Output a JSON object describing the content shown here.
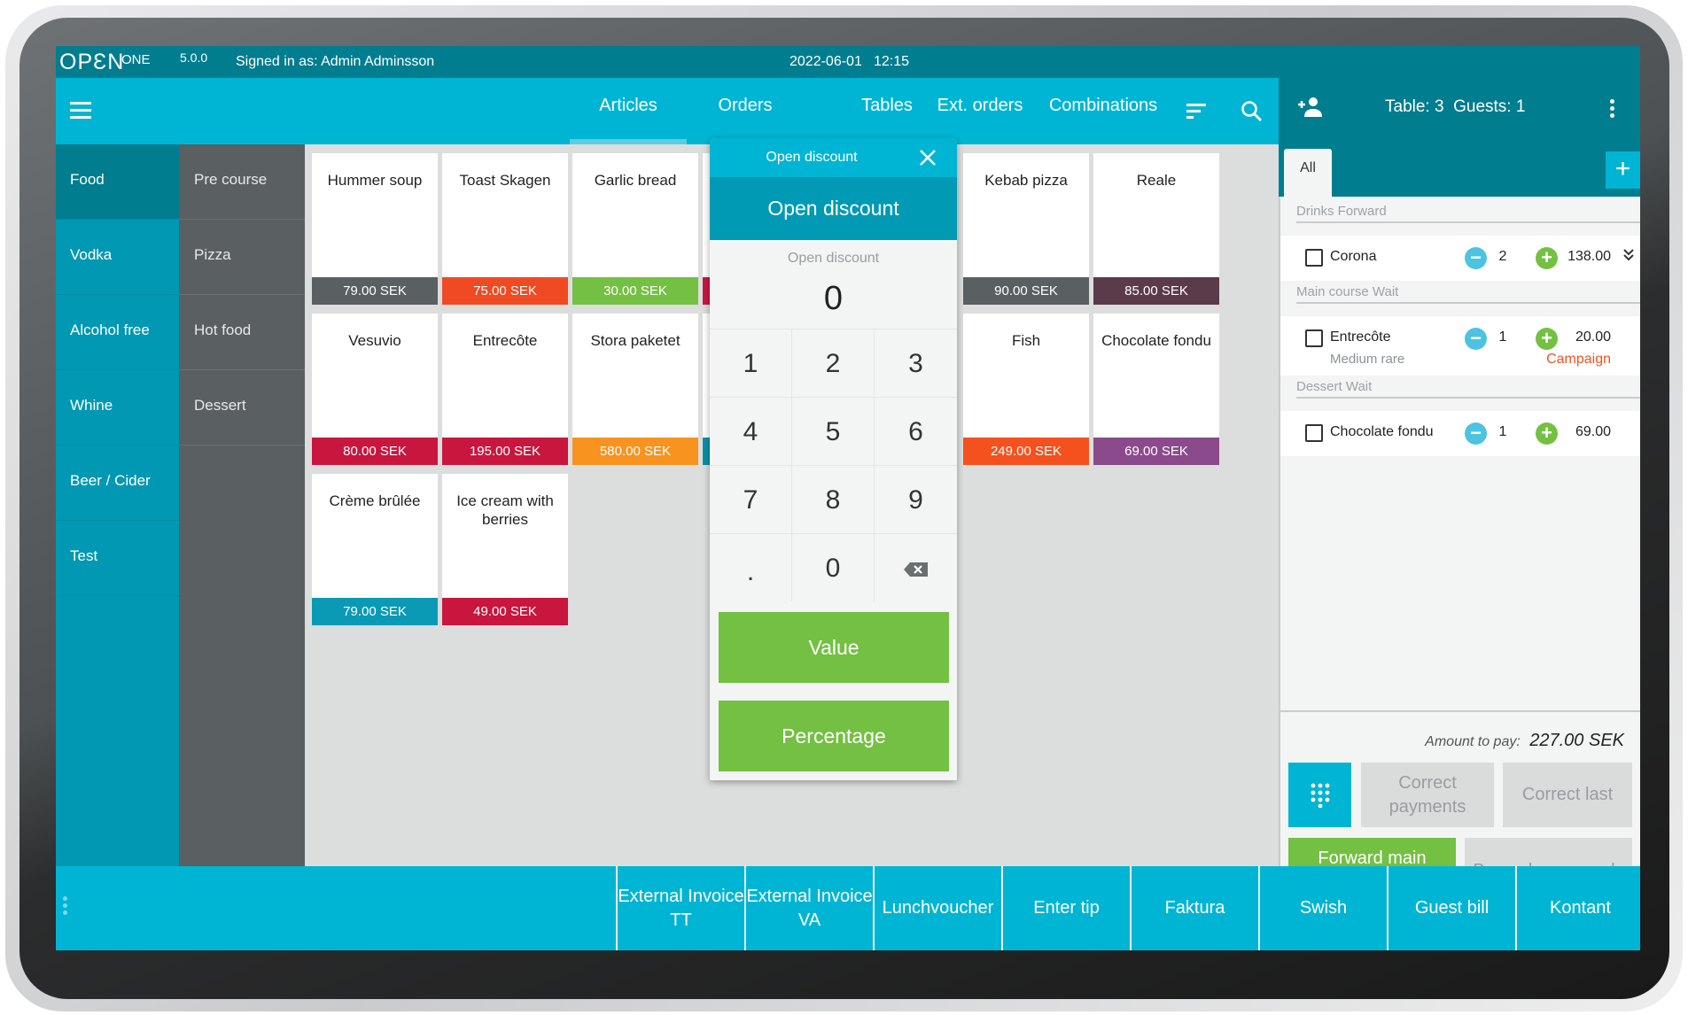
{
  "app": {
    "logo": "OPEN ONE",
    "version": "5.0.0",
    "signed_in": "Signed in as: Admin Adminsson",
    "date": "2022-06-01",
    "time": "12:15"
  },
  "nav": {
    "tabs": [
      {
        "label": "Articles",
        "active": true
      },
      {
        "label": "Orders"
      },
      {
        "label": "Tables"
      },
      {
        "label": "Ext. orders"
      },
      {
        "label": "Combinations"
      }
    ],
    "icons": [
      "menu-icon",
      "filter-icon",
      "search-icon"
    ]
  },
  "categories": [
    {
      "label": "Food",
      "selected": true
    },
    {
      "label": "Vodka"
    },
    {
      "label": "Alcohol free"
    },
    {
      "label": "Whine"
    },
    {
      "label": "Beer / Cider"
    },
    {
      "label": "Test"
    }
  ],
  "subcategories": [
    {
      "label": "Pre course"
    },
    {
      "label": "Pizza"
    },
    {
      "label": "Hot food"
    },
    {
      "label": "Dessert"
    }
  ],
  "articles": [
    {
      "name": "Hummer soup",
      "price": "79.00 SEK",
      "color": "#5a5f62",
      "row": 0,
      "col": 0
    },
    {
      "name": "Toast Skagen",
      "price": "75.00 SEK",
      "color": "#f04a23",
      "row": 0,
      "col": 1
    },
    {
      "name": "Garlic bread",
      "price": "30.00 SEK",
      "color": "#74c043",
      "row": 0,
      "col": 2
    },
    {
      "name": "",
      "price": "",
      "color": "#c8163f",
      "row": 0,
      "col": 3
    },
    {
      "name": "Kebab pizza",
      "price": "90.00 SEK",
      "color": "#5a5f62",
      "row": 0,
      "col": 5
    },
    {
      "name": "Reale",
      "price": "85.00 SEK",
      "color": "#5b3a4a",
      "row": 0,
      "col": 6
    },
    {
      "name": "Vesuvio",
      "price": "80.00 SEK",
      "color": "#c8163f",
      "row": 1,
      "col": 0
    },
    {
      "name": "Entrecôte",
      "price": "195.00 SEK",
      "color": "#c8163f",
      "row": 1,
      "col": 1
    },
    {
      "name": "Stora paketet",
      "price": "580.00 SEK",
      "color": "#f7931e",
      "row": 1,
      "col": 2
    },
    {
      "name": "",
      "price": "",
      "color": "#0a8fa8",
      "row": 1,
      "col": 3
    },
    {
      "name": "Fish",
      "price": "249.00 SEK",
      "color": "#f4511e",
      "row": 1,
      "col": 5
    },
    {
      "name": "Chocolate fondu",
      "price": "69.00 SEK",
      "color": "#8b4a8c",
      "row": 1,
      "col": 6
    },
    {
      "name": "Crème brûlée",
      "price": "79.00 SEK",
      "color": "#0a9ab5",
      "row": 2,
      "col": 0
    },
    {
      "name": "Ice cream with berries",
      "price": "49.00 SEK",
      "color": "#c8163f",
      "row": 2,
      "col": 1
    }
  ],
  "dialog": {
    "title": "Open discount",
    "banner": "Open discount",
    "field_label": "Open discount",
    "value": "0",
    "keys": [
      "1",
      "2",
      "3",
      "4",
      "5",
      "6",
      "7",
      "8",
      "9",
      ".",
      "0",
      "backspace"
    ],
    "value_button": "Value",
    "percentage_button": "Percentage"
  },
  "order": {
    "header": "Table: 3  Guests: 1",
    "tab": "All",
    "sections": [
      {
        "title": "Drinks Forward",
        "items": [
          {
            "name": "Corona",
            "qty": "2",
            "price": "138.00",
            "expand": true
          }
        ]
      },
      {
        "title": "Main course Wait",
        "items": [
          {
            "name": "Entrecôte",
            "note": "Medium rare",
            "qty": "1",
            "price": "20.00",
            "tag": "Campaign"
          }
        ]
      },
      {
        "title": "Dessert Wait",
        "items": [
          {
            "name": "Chocolate fondu",
            "qty": "1",
            "price": "69.00"
          }
        ]
      }
    ],
    "amount_label": "Amount to pay:",
    "amount": "227.00 SEK",
    "buttons": {
      "correct_payments": "Correct payments",
      "correct_last": "Correct last",
      "forward": "Forward main course",
      "bong": "Bong changes only"
    }
  },
  "payment_buttons": [
    "External Invoice TT",
    "External Invoice VA",
    "Lunchvoucher",
    "Enter tip",
    "Faktura",
    "Swish",
    "Guest bill",
    "Kontant"
  ],
  "colors": {
    "primary": "#00b5d4",
    "dark": "#007d8f",
    "green": "#74c043",
    "campaign": "#f4511e"
  }
}
